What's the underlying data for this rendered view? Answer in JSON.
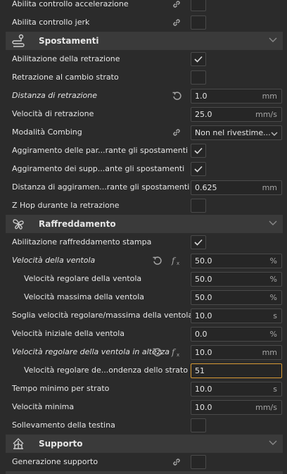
{
  "rows": [
    {
      "label": "Abilita controllo accelerazione",
      "type": "check",
      "checked": false,
      "link": true
    },
    {
      "label": "Abilita controllo jerk",
      "type": "check",
      "checked": false,
      "link": true
    },
    {
      "section": true,
      "title": "Spostamenti",
      "icon": "travel-icon"
    },
    {
      "label": "Abilitazione della retrazione",
      "type": "check",
      "checked": true
    },
    {
      "label": "Retrazione al cambio strato",
      "type": "check",
      "checked": false
    },
    {
      "label": "Distanza di retrazione",
      "italic": true,
      "type": "field",
      "value": "1.0",
      "unit": "mm",
      "reset": true
    },
    {
      "label": "Velocità di retrazione",
      "type": "field",
      "value": "25.0",
      "unit": "mm/s"
    },
    {
      "label": "Modalità Combing",
      "type": "dropdown",
      "value": "Non nel rivestime...",
      "link": true
    },
    {
      "label": "Aggiramento delle par...rante gli spostamenti",
      "type": "check",
      "checked": true
    },
    {
      "label": "Aggiramento dei supp...ante gli spostamenti",
      "type": "check",
      "checked": true
    },
    {
      "label": "Distanza di aggiramen...rante gli spostamenti",
      "type": "field",
      "value": "0.625",
      "unit": "mm"
    },
    {
      "label": "Z Hop durante la retrazione",
      "type": "check",
      "checked": false
    },
    {
      "section": true,
      "title": "Raffreddamento",
      "icon": "fan-icon"
    },
    {
      "label": "Abilitazione raffreddamento stampa",
      "type": "check",
      "checked": true
    },
    {
      "label": "Velocità della ventola",
      "italic": true,
      "type": "field",
      "value": "50.0",
      "unit": "%",
      "reset": true,
      "fx": true
    },
    {
      "label": "Velocità regolare della ventola",
      "indent": true,
      "type": "field",
      "value": "50.0",
      "unit": "%"
    },
    {
      "label": "Velocità massima della ventola",
      "indent": true,
      "type": "field",
      "value": "50.0",
      "unit": "%"
    },
    {
      "label": "Soglia velocità regolare/massima della ventola",
      "type": "field",
      "value": "10.0",
      "unit": "s"
    },
    {
      "label": "Velocità iniziale della ventola",
      "type": "field",
      "value": "0.0",
      "unit": "%"
    },
    {
      "label": "Velocità regolare della ventola in altezza",
      "italic": true,
      "type": "field",
      "value": "10.0",
      "unit": "mm",
      "reset": true,
      "fx": true
    },
    {
      "label": "Velocità regolare de...ondenza dello strato",
      "indent": true,
      "type": "field",
      "value": "51",
      "unit": "",
      "active": true
    },
    {
      "label": "Tempo minimo per strato",
      "type": "field",
      "value": "10.0",
      "unit": "s"
    },
    {
      "label": "Velocità minima",
      "type": "field",
      "value": "10.0",
      "unit": "mm/s"
    },
    {
      "label": "Sollevamento della testina",
      "type": "check",
      "checked": false
    },
    {
      "section": true,
      "title": "Supporto",
      "icon": "support-icon"
    },
    {
      "label": "Generazione supporto",
      "type": "check",
      "checked": false,
      "link": true
    }
  ],
  "colors": {
    "background": "#2b2b2b",
    "section": "#3a3a3a",
    "active_border": "#d79a35"
  }
}
